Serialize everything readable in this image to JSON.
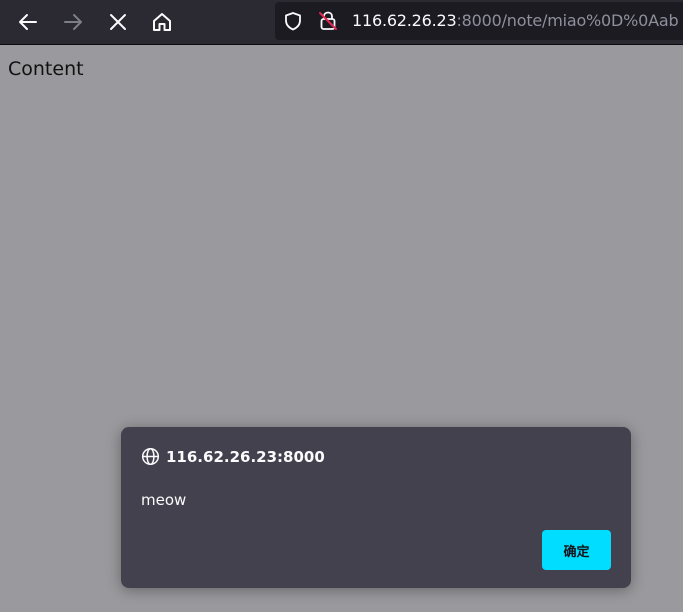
{
  "toolbar": {
    "icons": [
      "back-arrow-icon",
      "forward-arrow-icon",
      "close-icon",
      "home-icon"
    ],
    "address": {
      "host": "116.62.26.23",
      "rest": ":8000/note/miao%0D%0Aab",
      "icons": [
        "shield-icon",
        "insecure-lock-icon"
      ]
    }
  },
  "page": {
    "content": "Content"
  },
  "dialog": {
    "origin": "116.62.26.23:8000",
    "message": "meow",
    "ok_label": "确定",
    "icon": "globe-icon"
  },
  "colors": {
    "toolbar_bg": "#2b2a33",
    "urlbar_bg": "#1c1b22",
    "page_overlay_bg": "#9a999d",
    "dialog_bg": "#42414d",
    "accent": "#00ddff",
    "insecure_red": "#e22850"
  }
}
